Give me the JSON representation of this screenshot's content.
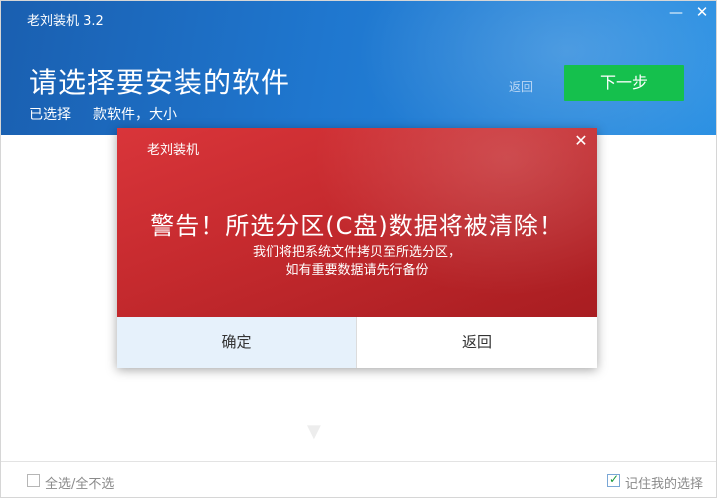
{
  "window": {
    "title": "老刘装机 3.2",
    "minimize_icon": "minimize-icon",
    "close_icon": "close-icon"
  },
  "header": {
    "heading": "请选择要安装的软件",
    "selected_prefix": "已选择",
    "selected_suffix": "款软件，大小",
    "back_label": "返回",
    "next_label": "下一步"
  },
  "dialog": {
    "title": "老刘装机",
    "warning": "警告！所选分区(C盘)数据将被清除！",
    "description_line1": "我们将把系统文件拷贝至所选分区，",
    "description_line2": "如有重要数据请先行备份",
    "confirm_label": "确定",
    "back_label": "返回",
    "close_icon": "close-icon"
  },
  "footer": {
    "select_all_label": "全选/全不选",
    "select_all_checked": false,
    "remember_label": "记住我的选择",
    "remember_checked": true
  },
  "colors": {
    "header_blue": "#1f77cf",
    "next_green": "#15c04d",
    "dialog_red": "#c52a2e",
    "confirm_bg": "#e6f1fb"
  }
}
